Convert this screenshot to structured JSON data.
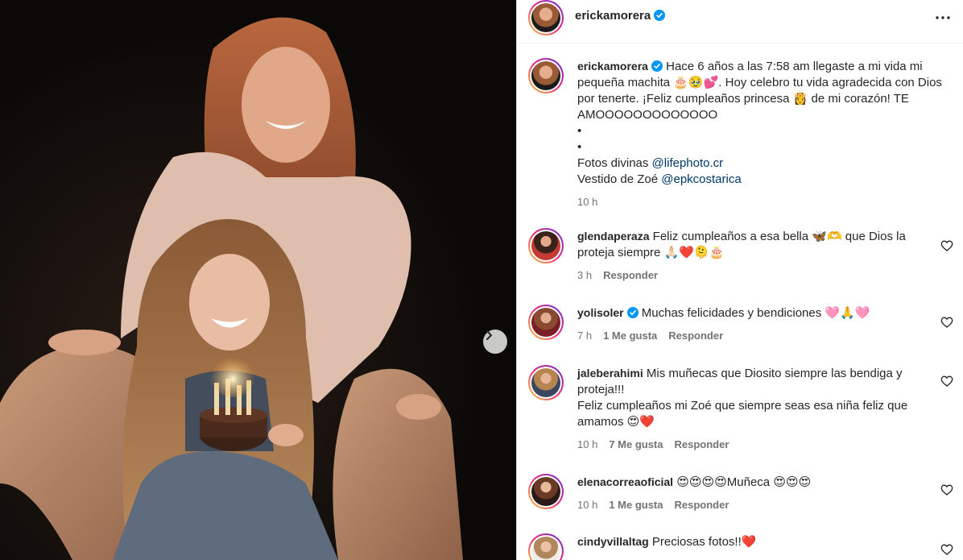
{
  "post": {
    "author": "erickamorera",
    "verified": true
  },
  "caption": {
    "lines": [
      "Hace 6 años a las 7:58 am llegaste a mi vida mi pequeña machita 🎂🥹💕. Hoy celebro tu vida agradecida con Dios por tenerte. ¡Feliz cumpleaños princesa 👸 de mi corazón! TE AMOOOOOOOOOOOOO",
      "•",
      "•"
    ],
    "photos_prefix": "Fotos divinas ",
    "photos_mention": "@lifephoto.cr",
    "dress_prefix": "Vestido de Zoé ",
    "dress_mention": "@epkcostarica",
    "time": "10 h"
  },
  "comments": [
    {
      "user": "glendaperaza",
      "verified": false,
      "text": "Feliz cumpleaños a esa bella 🦋🫶 que Dios la proteja siempre 🙏🏻❤️🫠🎂",
      "time": "3 h",
      "likes": "",
      "reply": "Responder"
    },
    {
      "user": "yolisoler",
      "verified": true,
      "text": "Muchas felicidades y bendiciones 🩷🙏🩷",
      "time": "7 h",
      "likes": "1 Me gusta",
      "reply": "Responder"
    },
    {
      "user": "jaleberahimi",
      "verified": false,
      "text": "Mis muñecas que Diosito siempre las bendiga y proteja!!!",
      "text2": "Feliz cumpleaños mi Zoé que siempre seas esa niña feliz que amamos 😍❤️",
      "time": "10 h",
      "likes": "7 Me gusta",
      "reply": "Responder"
    },
    {
      "user": "elenacorreaoficial",
      "verified": false,
      "text": "😍😍😍😍Muñeca 😍😍😍",
      "time": "10 h",
      "likes": "1 Me gusta",
      "reply": "Responder"
    },
    {
      "user": "cindyvillaltag",
      "verified": false,
      "text": "Preciosas fotos!!❤️",
      "time": "",
      "likes": "",
      "reply": ""
    }
  ],
  "icons": {
    "verified": "verified-badge-icon",
    "more": "more-options-icon",
    "like": "heart-outline-icon",
    "next": "chevron-right-icon"
  },
  "colors": {
    "verified": "#0095f6",
    "mention": "#00376b",
    "muted": "#737373"
  }
}
